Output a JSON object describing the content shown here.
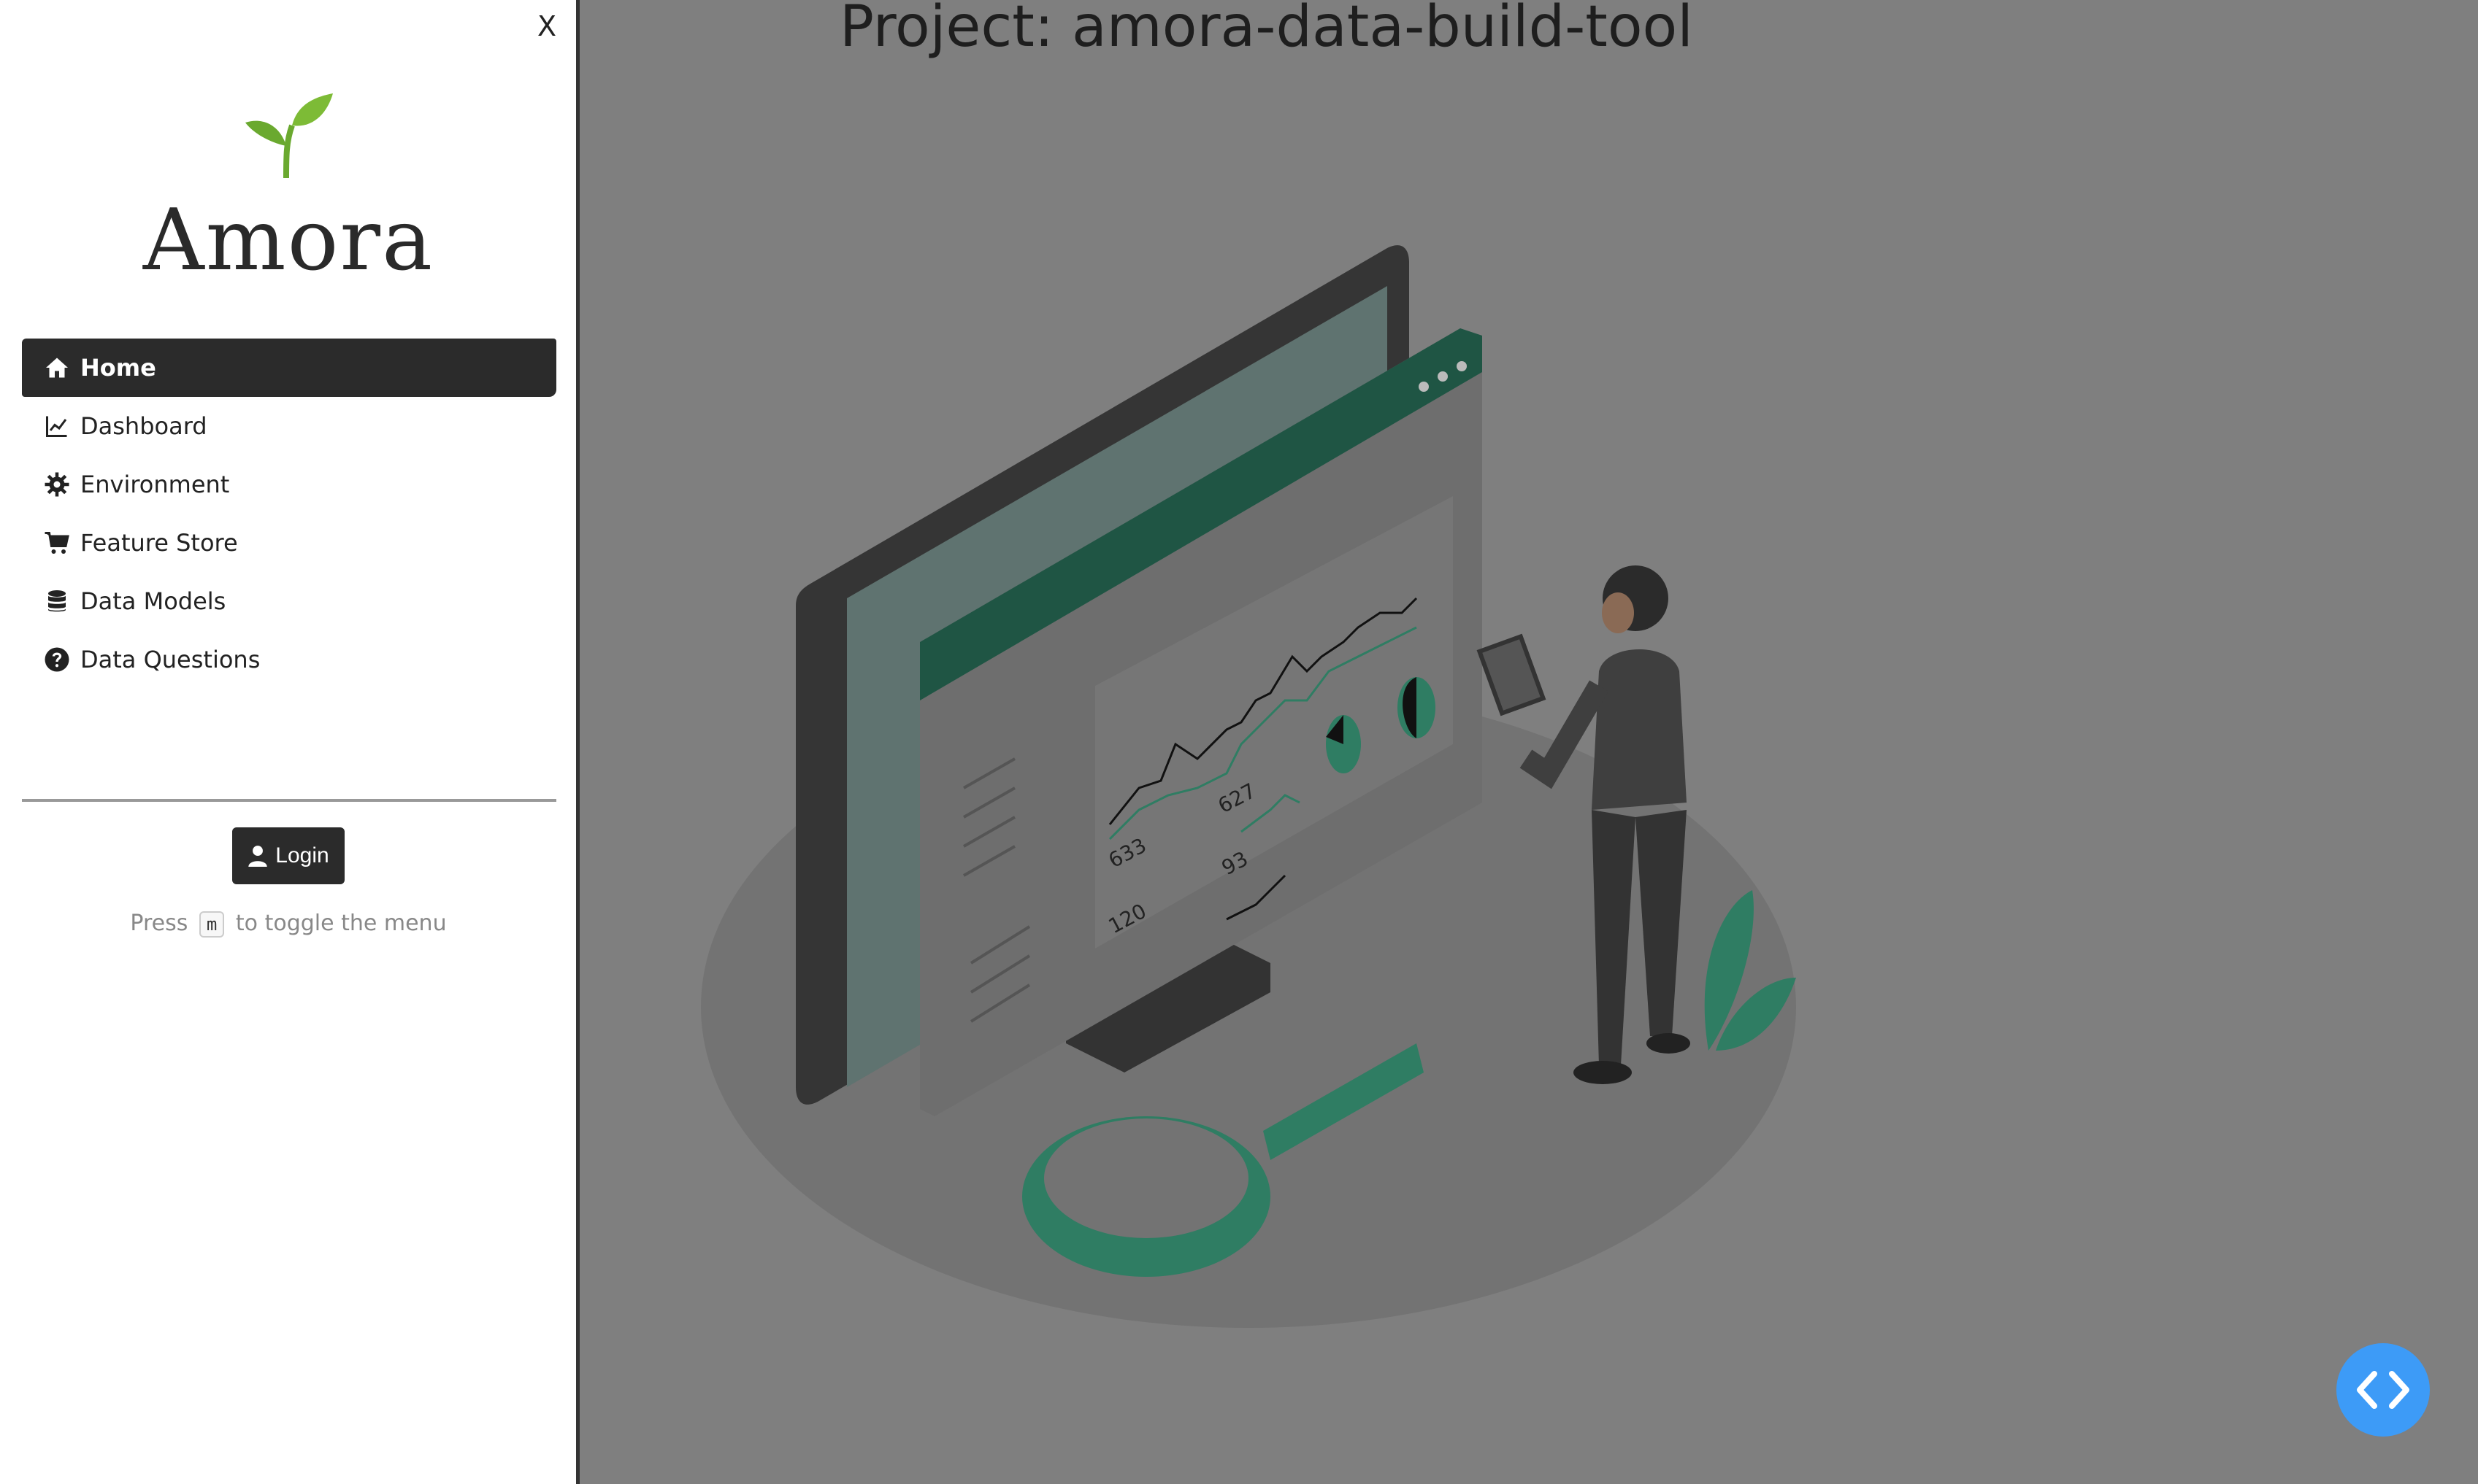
{
  "sidebar": {
    "close_label": "X",
    "brand": "Amora",
    "logo_icon": "sprout-icon",
    "items": [
      {
        "label": "Home",
        "icon": "home-icon",
        "active": true
      },
      {
        "label": "Dashboard",
        "icon": "chart-line-icon",
        "active": false
      },
      {
        "label": "Environment",
        "icon": "gear-icon",
        "active": false
      },
      {
        "label": "Feature Store",
        "icon": "cart-icon",
        "active": false
      },
      {
        "label": "Data Models",
        "icon": "database-icon",
        "active": false
      },
      {
        "label": "Data Questions",
        "icon": "question-circle-icon",
        "active": false
      }
    ],
    "login_label": "Login",
    "hint_before": "Press",
    "hint_key": "m",
    "hint_after": "to toggle the menu"
  },
  "main": {
    "title": "Project: amora-data-build-tool",
    "illustration_numbers": [
      "627",
      "633",
      "93",
      "120"
    ]
  },
  "fab": {
    "icon": "code-icon"
  },
  "colors": {
    "sidebar_bg": "#ffffff",
    "main_bg": "#7f7f7f",
    "active_item": "#2b2b2b",
    "accent_green": "#2f7d63",
    "fab_blue": "#3d9bf7"
  }
}
